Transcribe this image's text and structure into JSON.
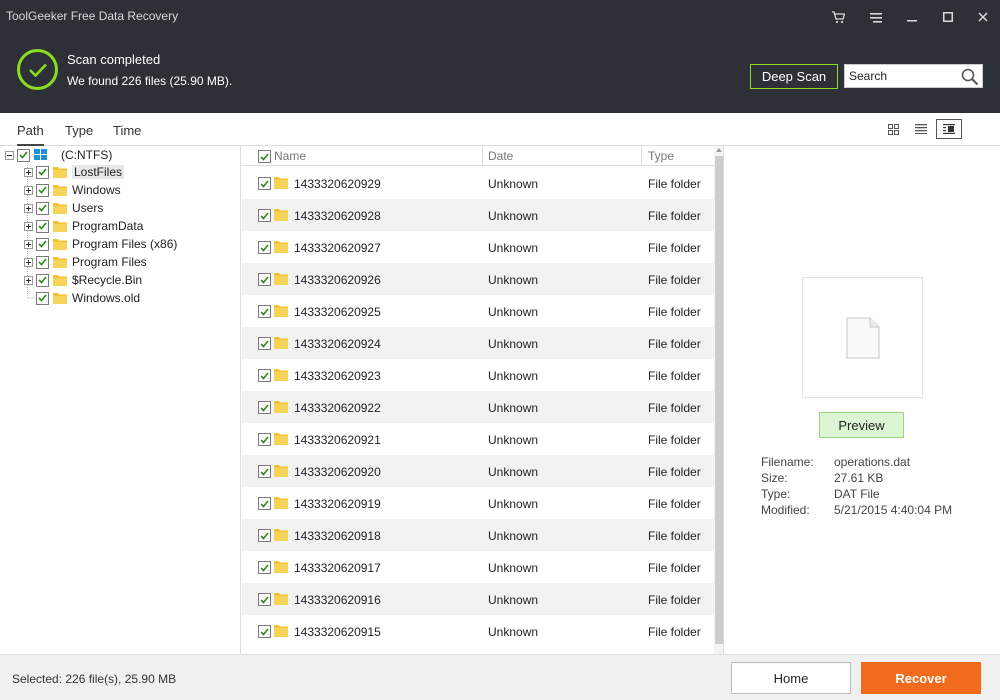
{
  "window": {
    "title": "ToolGeeker Free Data Recovery"
  },
  "header": {
    "status_title": "Scan completed",
    "status_detail": "We found 226 files (25.90 MB).",
    "deep_scan_label": "Deep Scan",
    "search_placeholder": "Search",
    "accent_color": "#8cdd1f"
  },
  "tabs": [
    {
      "label": "Path",
      "active": true
    },
    {
      "label": "Type",
      "active": false
    },
    {
      "label": "Time",
      "active": false
    }
  ],
  "tree": {
    "root": "(C:NTFS)",
    "children": [
      {
        "label": "LostFiles",
        "selected": true
      },
      {
        "label": "Windows"
      },
      {
        "label": "Users"
      },
      {
        "label": "ProgramData"
      },
      {
        "label": "Program Files (x86)"
      },
      {
        "label": "Program Files"
      },
      {
        "label": "$Recycle.Bin"
      },
      {
        "label": "Windows.old"
      }
    ]
  },
  "list": {
    "columns": [
      "Name",
      "Date",
      "Type"
    ],
    "rows": [
      {
        "name": "1433320620929",
        "date": "Unknown",
        "type": "File folder"
      },
      {
        "name": "1433320620928",
        "date": "Unknown",
        "type": "File folder"
      },
      {
        "name": "1433320620927",
        "date": "Unknown",
        "type": "File folder"
      },
      {
        "name": "1433320620926",
        "date": "Unknown",
        "type": "File folder"
      },
      {
        "name": "1433320620925",
        "date": "Unknown",
        "type": "File folder"
      },
      {
        "name": "1433320620924",
        "date": "Unknown",
        "type": "File folder"
      },
      {
        "name": "1433320620923",
        "date": "Unknown",
        "type": "File folder"
      },
      {
        "name": "1433320620922",
        "date": "Unknown",
        "type": "File folder"
      },
      {
        "name": "1433320620921",
        "date": "Unknown",
        "type": "File folder"
      },
      {
        "name": "1433320620920",
        "date": "Unknown",
        "type": "File folder"
      },
      {
        "name": "1433320620919",
        "date": "Unknown",
        "type": "File folder"
      },
      {
        "name": "1433320620918",
        "date": "Unknown",
        "type": "File folder"
      },
      {
        "name": "1433320620917",
        "date": "Unknown",
        "type": "File folder"
      },
      {
        "name": "1433320620916",
        "date": "Unknown",
        "type": "File folder"
      },
      {
        "name": "1433320620915",
        "date": "Unknown",
        "type": "File folder"
      }
    ]
  },
  "preview": {
    "button_label": "Preview",
    "meta": [
      {
        "key": "Filename:",
        "value": "operations.dat"
      },
      {
        "key": "Size:",
        "value": "27.61 KB"
      },
      {
        "key": "Type:",
        "value": "DAT File"
      },
      {
        "key": "Modified:",
        "value": "5/21/2015 4:40:04 PM"
      }
    ]
  },
  "footer": {
    "selected_text": "Selected: 226 file(s), 25.90 MB",
    "home_label": "Home",
    "recover_label": "Recover",
    "recover_color": "#f26b1d"
  },
  "icons": [
    "cart-icon",
    "menu-icon",
    "minimize-icon",
    "maximize-icon",
    "close-icon",
    "check-icon",
    "search-icon",
    "grid-view-icon",
    "list-view-icon",
    "detail-view-icon",
    "drive-icon",
    "folder-icon",
    "file-icon"
  ]
}
